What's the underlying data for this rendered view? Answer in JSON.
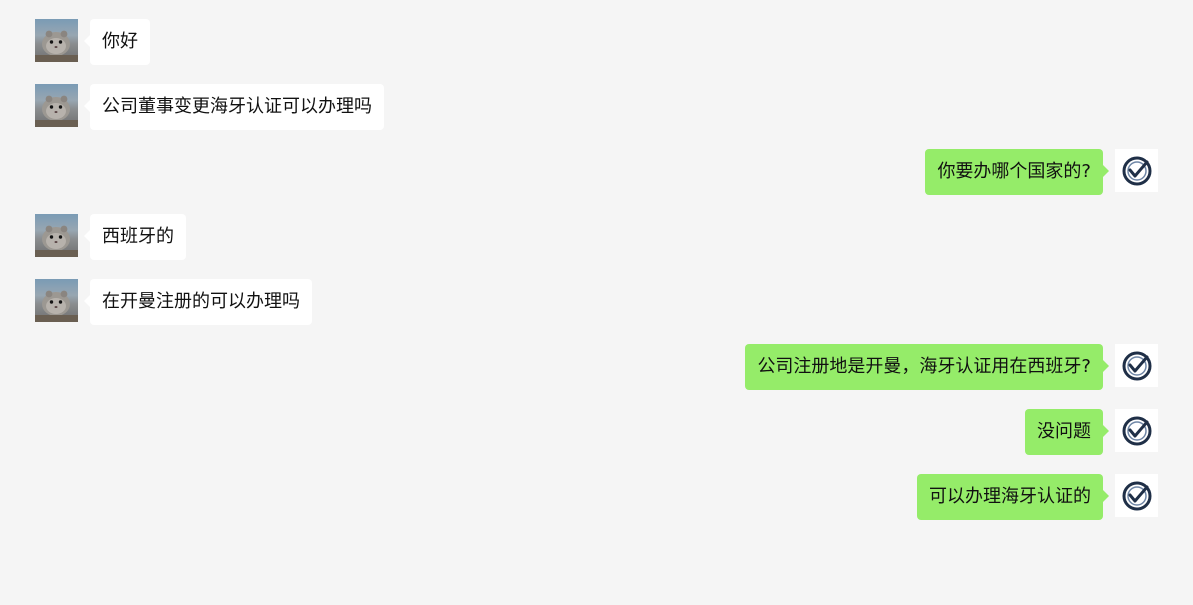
{
  "messages": [
    {
      "side": "left",
      "avatar": "hamster-avatar",
      "text": "你好"
    },
    {
      "side": "left",
      "avatar": "hamster-avatar",
      "text": "公司董事变更海牙认证可以办理吗"
    },
    {
      "side": "right",
      "avatar": "checkmark-avatar",
      "text": "你要办哪个国家的?"
    },
    {
      "side": "left",
      "avatar": "hamster-avatar",
      "text": "西班牙的"
    },
    {
      "side": "left",
      "avatar": "hamster-avatar",
      "text": "在开曼注册的可以办理吗"
    },
    {
      "side": "right",
      "avatar": "checkmark-avatar",
      "text": "公司注册地是开曼，海牙认证用在西班牙?"
    },
    {
      "side": "right",
      "avatar": "checkmark-avatar",
      "text": "没问题"
    },
    {
      "side": "right",
      "avatar": "checkmark-avatar",
      "text": "可以办理海牙认证的"
    }
  ],
  "colors": {
    "background": "#f5f5f5",
    "incoming_bubble": "#ffffff",
    "outgoing_bubble": "#95ec69",
    "text": "#111111"
  }
}
